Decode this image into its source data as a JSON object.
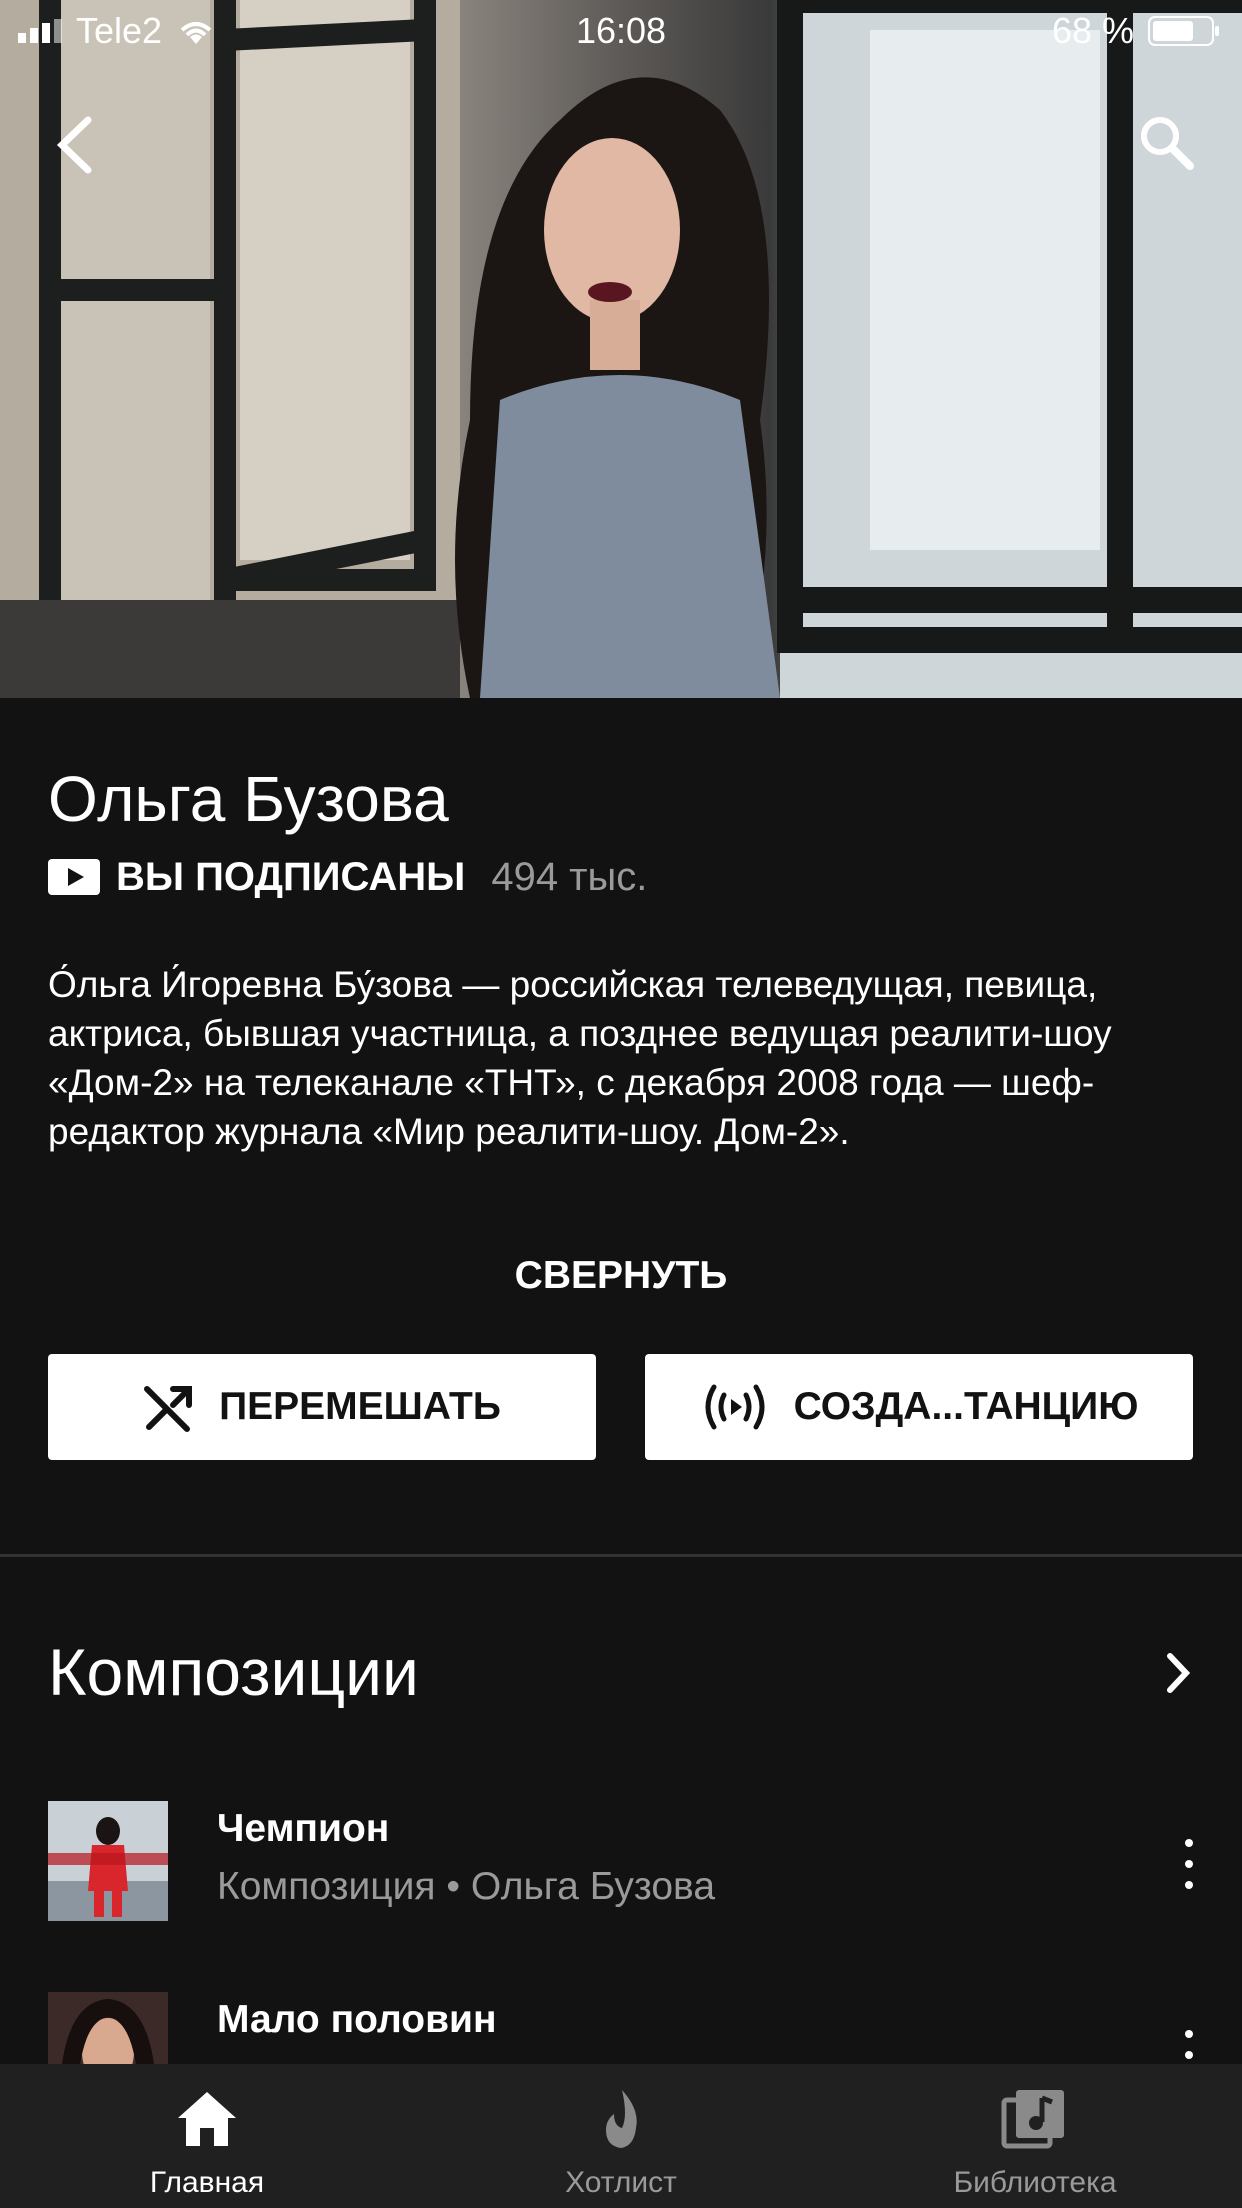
{
  "status_bar": {
    "carrier": "Tele2",
    "time": "16:08",
    "battery": "68 %"
  },
  "artist": {
    "name": "Ольга Бузова",
    "subscribe_label": "ВЫ ПОДПИСАНЫ",
    "subscriber_count": "494 тыс.",
    "description": "О́льга И́горевна Бу́зова — российская телеведущая, певица, актриса, бывшая участница, а позднее ведущая реалити-шоу «Дом-2» на телеканале «ТНТ», с декабря 2008 года — шеф-редактор журнала «Мир реалити-шоу. Дом-2».",
    "collapse_label": "СВЕРНУТЬ"
  },
  "actions": {
    "shuffle_label": "ПЕРЕМЕШАТЬ",
    "radio_label": "СОЗДА...ТАНЦИЮ"
  },
  "songs_section": {
    "title": "Композиции",
    "items": [
      {
        "title": "Чемпион",
        "meta": "Композиция • Ольга Бузова"
      },
      {
        "title": "Мало половин",
        "meta": ""
      }
    ]
  },
  "bottom_nav": [
    {
      "label": "Главная",
      "icon": "home-icon",
      "active": true
    },
    {
      "label": "Хотлист",
      "icon": "flame-icon",
      "active": false
    },
    {
      "label": "Библиотека",
      "icon": "library-icon",
      "active": false
    }
  ]
}
